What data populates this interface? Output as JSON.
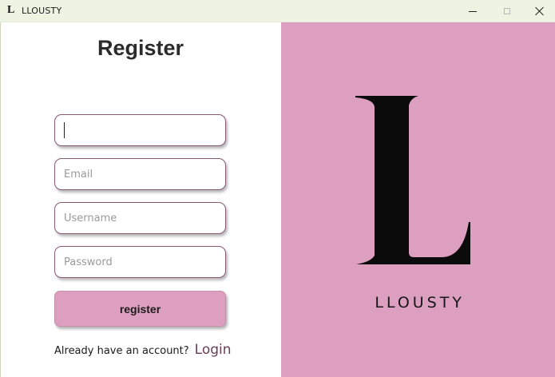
{
  "window": {
    "title": "LLOUSTY",
    "icon": "L",
    "controls": [
      "minimize",
      "maximize",
      "close"
    ]
  },
  "form": {
    "heading": "Register",
    "fields": [
      {
        "name": "first",
        "value": "",
        "placeholder": ""
      },
      {
        "name": "email",
        "value": "",
        "placeholder": "Email"
      },
      {
        "name": "username",
        "value": "",
        "placeholder": "Username"
      },
      {
        "name": "password",
        "value": "",
        "placeholder": "Password"
      }
    ],
    "submit_label": "register",
    "login_prompt": "Already have an account?",
    "login_link": "Login"
  },
  "brand": {
    "logo_letter": "L",
    "name": "LLOUSTY"
  },
  "colors": {
    "accent_pink": "#dc9fbf",
    "titlebar": "#eef4e2",
    "field_border": "#8a5a72",
    "link": "#6a3d55"
  }
}
